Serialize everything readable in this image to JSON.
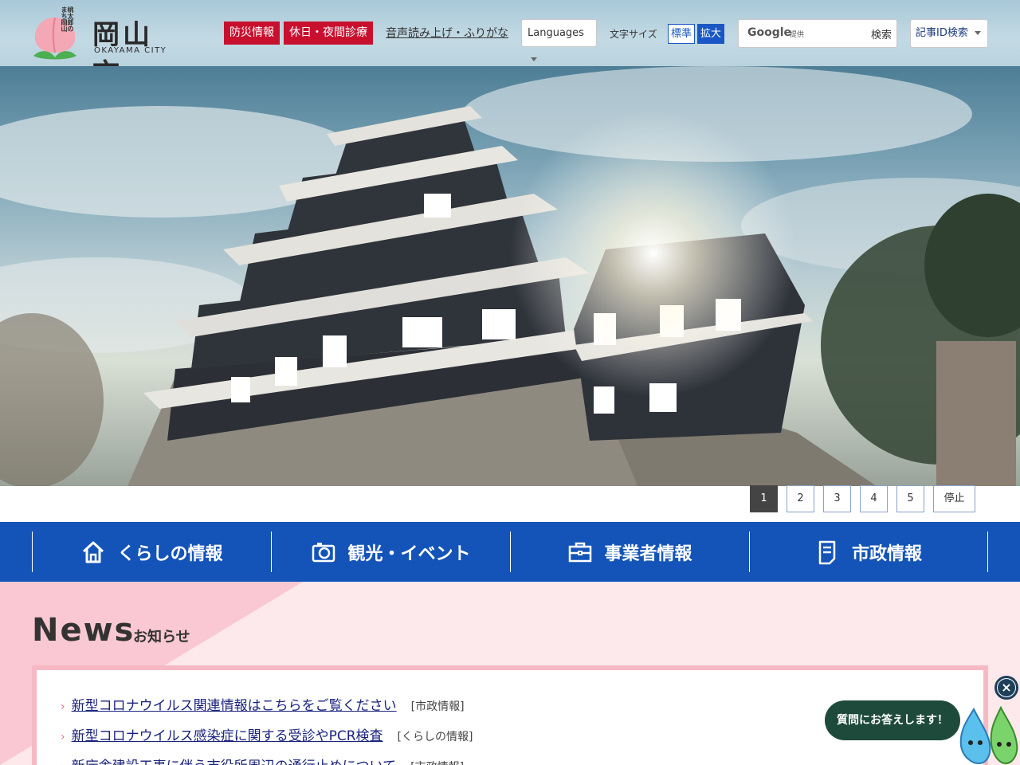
{
  "header": {
    "logo": {
      "title": "岡山市",
      "subtitle": "OKAYAMA CITY",
      "vertical_text": "桃太郎のまち岡山"
    },
    "disaster_label": "防災情報",
    "clinic_label": "休日・夜間診療",
    "furigana_label": "音声読み上げ・ふりがな",
    "languages_label": "Languages",
    "font_size_label": "文字サイズ",
    "font_standard": "標準",
    "font_large": "拡大",
    "search": {
      "provider": "Google",
      "provided": "提供",
      "placeholder": "",
      "button": "検索"
    },
    "article_id_label": "記事ID検索"
  },
  "hero": {
    "pagers": [
      "1",
      "2",
      "3",
      "4",
      "5"
    ],
    "active_page": "1",
    "stop_label": "停止"
  },
  "nav": {
    "items": [
      {
        "label": "くらしの情報",
        "icon": "home-icon"
      },
      {
        "label": "観光・イベント",
        "icon": "camera-icon"
      },
      {
        "label": "事業者情報",
        "icon": "briefcase-icon"
      },
      {
        "label": "市政情報",
        "icon": "document-icon"
      }
    ]
  },
  "news": {
    "title": "News",
    "subtitle": "お知らせ",
    "items": [
      {
        "text": "新型コロナウイルス関連情報はこちらをご覧ください",
        "category": "[市政情報]"
      },
      {
        "text": "新型コロナウイルス感染症に関する受診やPCR検査",
        "category": "[くらしの情報]"
      },
      {
        "text": "新庁舎建設工事に伴う市役所周辺の通行止めについて",
        "category": "[市政情報]"
      }
    ]
  },
  "chat": {
    "bubble": "質問にお答えします！",
    "close": "×"
  },
  "colors": {
    "nav_blue": "#1454b8",
    "alert_red": "#c8102e",
    "news_pink": "#fde8ec",
    "chat_green": "#1e4a3c"
  }
}
